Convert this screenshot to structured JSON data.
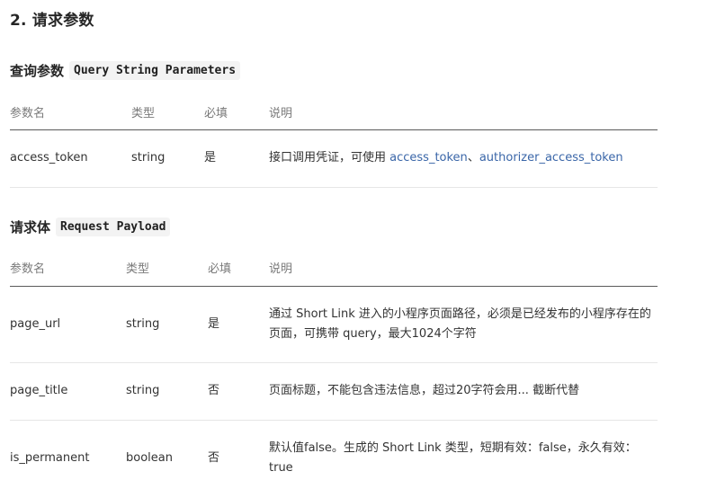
{
  "section": {
    "title": "2. 请求参数"
  },
  "query": {
    "title": "查询参数",
    "code": "Query String Parameters",
    "headers": {
      "name": "参数名",
      "type": "类型",
      "required": "必填",
      "desc": "说明"
    },
    "rows": [
      {
        "name": "access_token",
        "type": "string",
        "required": "是",
        "desc_prefix": "接口调用凭证，可使用 ",
        "link1": "access_token",
        "sep": "、",
        "link2": "authorizer_access_token"
      }
    ]
  },
  "payload": {
    "title": "请求体",
    "code": "Request Payload",
    "headers": {
      "name": "参数名",
      "type": "类型",
      "required": "必填",
      "desc": "说明"
    },
    "rows": [
      {
        "name": "page_url",
        "type": "string",
        "required": "是",
        "desc": "通过 Short Link 进入的小程序页面路径，必须是已经发布的小程序存在的页面，可携带 query，最大1024个字符"
      },
      {
        "name": "page_title",
        "type": "string",
        "required": "否",
        "desc": "页面标题，不能包含违法信息，超过20字符会用... 截断代替"
      },
      {
        "name": "is_permanent",
        "type": "boolean",
        "required": "否",
        "desc": "默认值false。生成的 Short Link 类型，短期有效：false，永久有效：true"
      }
    ]
  }
}
